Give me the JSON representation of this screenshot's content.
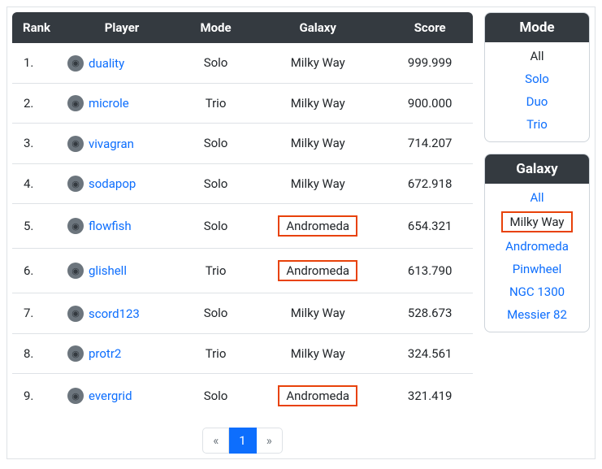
{
  "table": {
    "headers": {
      "rank": "Rank",
      "player": "Player",
      "mode": "Mode",
      "galaxy": "Galaxy",
      "score": "Score"
    },
    "rows": [
      {
        "rank": "1.",
        "player": "duality",
        "mode": "Solo",
        "galaxy": "Milky Way",
        "score": "999.999",
        "hl": false
      },
      {
        "rank": "2.",
        "player": "microle",
        "mode": "Trio",
        "galaxy": "Milky Way",
        "score": "900.000",
        "hl": false
      },
      {
        "rank": "3.",
        "player": "vivagran",
        "mode": "Solo",
        "galaxy": "Milky Way",
        "score": "714.207",
        "hl": false
      },
      {
        "rank": "4.",
        "player": "sodapop",
        "mode": "Solo",
        "galaxy": "Milky Way",
        "score": "672.918",
        "hl": false
      },
      {
        "rank": "5.",
        "player": "flowfish",
        "mode": "Solo",
        "galaxy": "Andromeda",
        "score": "654.321",
        "hl": true
      },
      {
        "rank": "6.",
        "player": "glishell",
        "mode": "Trio",
        "galaxy": "Andromeda",
        "score": "613.790",
        "hl": true
      },
      {
        "rank": "7.",
        "player": "scord123",
        "mode": "Solo",
        "galaxy": "Milky Way",
        "score": "528.673",
        "hl": false
      },
      {
        "rank": "8.",
        "player": "protr2",
        "mode": "Trio",
        "galaxy": "Milky Way",
        "score": "324.561",
        "hl": false
      },
      {
        "rank": "9.",
        "player": "evergrid",
        "mode": "Solo",
        "galaxy": "Andromeda",
        "score": "321.419",
        "hl": true
      }
    ]
  },
  "pagination": {
    "prev": "«",
    "page": "1",
    "next": "»"
  },
  "filters": {
    "mode": {
      "title": "Mode",
      "items": [
        {
          "label": "All",
          "state": "active-plain"
        },
        {
          "label": "Solo",
          "state": ""
        },
        {
          "label": "Duo",
          "state": ""
        },
        {
          "label": "Trio",
          "state": ""
        }
      ]
    },
    "galaxy": {
      "title": "Galaxy",
      "items": [
        {
          "label": "All",
          "state": ""
        },
        {
          "label": "Milky Way",
          "state": "active-box"
        },
        {
          "label": "Andromeda",
          "state": ""
        },
        {
          "label": "Pinwheel",
          "state": ""
        },
        {
          "label": "NGC 1300",
          "state": ""
        },
        {
          "label": "Messier 82",
          "state": ""
        }
      ]
    }
  },
  "colors": {
    "link": "#0d6efd",
    "highlight_border": "#e8420a",
    "header_bg": "#343a40"
  }
}
